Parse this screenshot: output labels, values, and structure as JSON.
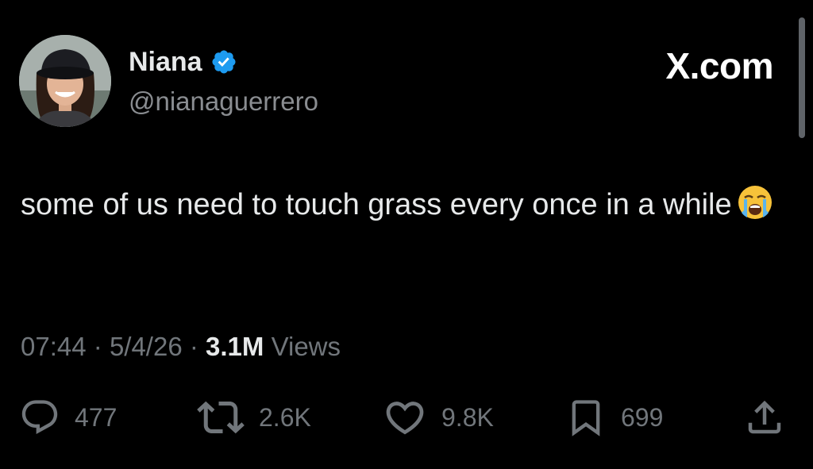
{
  "author": {
    "name": "Niana",
    "handle": "@nianaguerrero",
    "verified": true
  },
  "brand": "X.com",
  "tweet": {
    "text": "some of us need to touch grass every once in a while",
    "emoji": "loudly-crying-face"
  },
  "meta": {
    "time": "07:44",
    "separator": "·",
    "date": "5/4/26",
    "views_count": "3.1M",
    "views_label": "Views"
  },
  "actions": {
    "replies": "477",
    "reposts": "2.6K",
    "likes": "9.8K",
    "bookmarks": "699"
  },
  "colors": {
    "background": "#000000",
    "text_primary": "#e7e9ea",
    "text_secondary": "#71767b",
    "verified_blue": "#1d9bf0"
  }
}
